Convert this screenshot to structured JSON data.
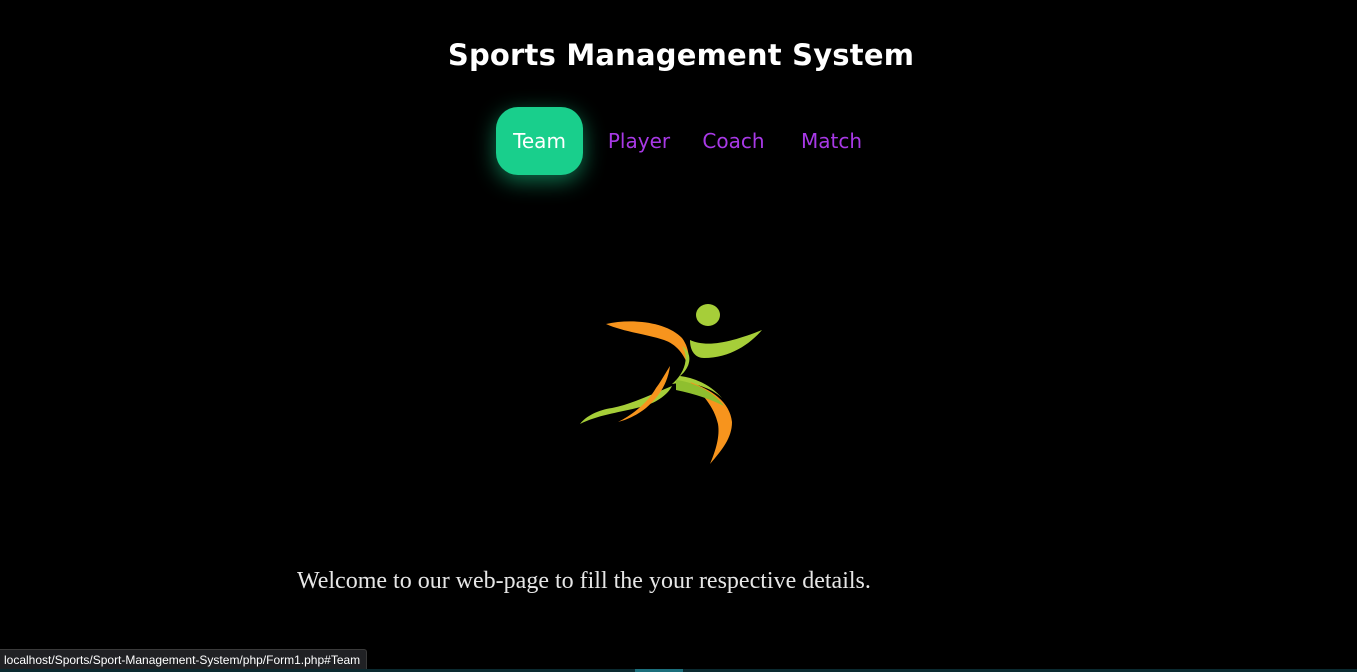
{
  "header": {
    "title": "Sports Management System"
  },
  "nav": {
    "items": [
      {
        "label": "Team",
        "active": true
      },
      {
        "label": "Player",
        "active": false
      },
      {
        "label": "Coach",
        "active": false
      },
      {
        "label": "Match",
        "active": false
      }
    ],
    "active_color": "#19cf8c",
    "link_color": "#a839e6"
  },
  "logo": {
    "icon": "running-figure-icon",
    "colors": [
      "#f7941d",
      "#a6ce39"
    ]
  },
  "main": {
    "welcome_text": "Welcome to our web-page to fill the your respective details."
  },
  "status_bar": {
    "url": "localhost/Sports/Sport-Management-System/php/Form1.php#Team"
  }
}
